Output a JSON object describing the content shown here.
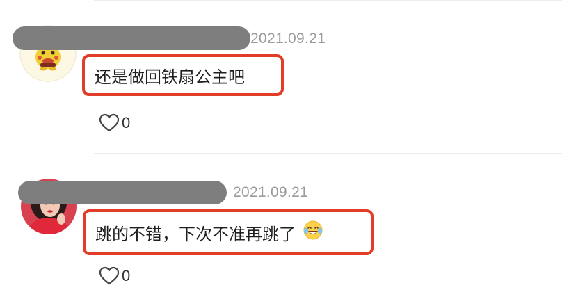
{
  "comments": [
    {
      "date": "2021.09.21",
      "text": "还是做回铁扇公主吧",
      "likes": "0",
      "avatar": "pikachu-avatar-icon",
      "has_emoji": false
    },
    {
      "date": "2021.09.21",
      "text": "跳的不错，下次不准再跳了",
      "likes": "0",
      "avatar": "woman-avatar-icon",
      "has_emoji": true,
      "emoji": "laughing-tears-emoji-icon"
    }
  ],
  "colors": {
    "highlight_border": "#e23d28",
    "date_text": "#9b9b9b",
    "redaction": "#7e7e7e",
    "divider": "#ececec"
  }
}
